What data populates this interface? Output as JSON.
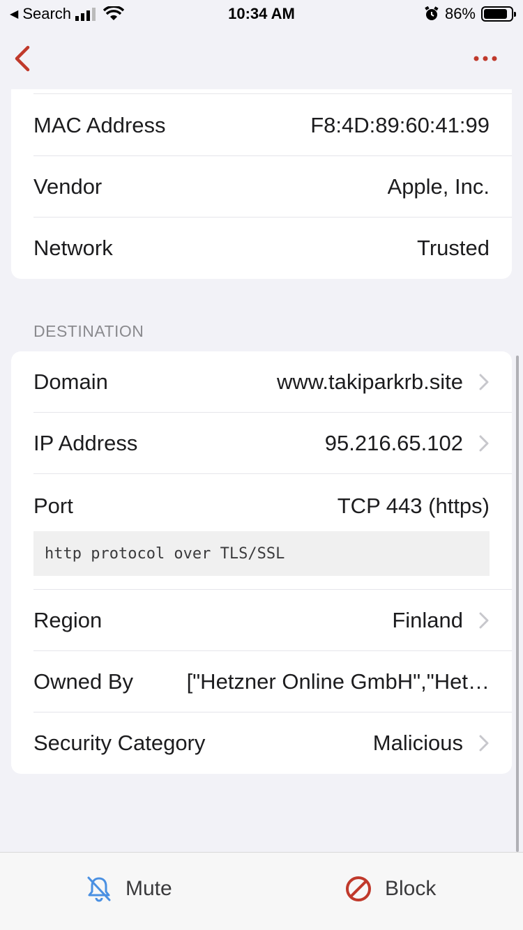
{
  "status_bar": {
    "back_app": "Search",
    "time": "10:34 AM",
    "battery": "86%",
    "battery_level": 0.86
  },
  "nav": {
    "back_icon": "chevron-left-icon",
    "more_icon": "ellipsis-icon",
    "accent_color": "#c0392b"
  },
  "device_section": {
    "rows": [
      {
        "label": "MAC Address",
        "value": "F8:4D:89:60:41:99"
      },
      {
        "label": "Vendor",
        "value": "Apple, Inc."
      },
      {
        "label": "Network",
        "value": "Trusted"
      }
    ]
  },
  "destination_section": {
    "header": "DESTINATION",
    "rows": [
      {
        "label": "Domain",
        "value": "www.takiparkrb.site"
      },
      {
        "label": "IP Address",
        "value": "95.216.65.102"
      },
      {
        "label": "Port",
        "value": "TCP 443 (https)",
        "note": "http protocol over TLS/SSL"
      },
      {
        "label": "Region",
        "value": "Finland"
      },
      {
        "label": "Owned By",
        "value": "[\"Hetzner Online GmbH\",\"Het…"
      },
      {
        "label": "Security Category",
        "value": "Malicious"
      }
    ]
  },
  "toolbar": {
    "mute_label": "Mute",
    "mute_icon": "bell-slash-icon",
    "mute_color": "#4a90e2",
    "block_label": "Block",
    "block_icon": "prohibited-icon",
    "block_color": "#c0392b"
  }
}
